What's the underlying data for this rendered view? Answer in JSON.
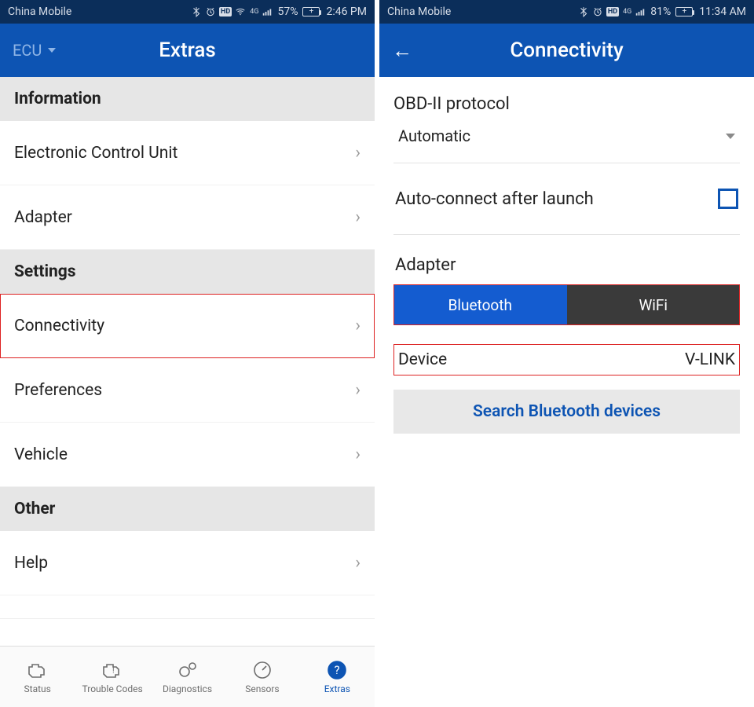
{
  "left": {
    "statusbar": {
      "carrier": "China Mobile",
      "battery_pct": "57%",
      "time": "2:46 PM"
    },
    "appbar": {
      "ecu_label": "ECU",
      "title": "Extras"
    },
    "sections": {
      "information": {
        "header": "Information",
        "items": [
          "Electronic Control Unit",
          "Adapter"
        ]
      },
      "settings": {
        "header": "Settings",
        "items": [
          "Connectivity",
          "Preferences",
          "Vehicle"
        ]
      },
      "other": {
        "header": "Other",
        "items": [
          "Help"
        ]
      }
    },
    "bottomnav": {
      "tabs": [
        "Status",
        "Trouble Codes",
        "Diagnostics",
        "Sensors",
        "Extras"
      ],
      "active_index": 4
    }
  },
  "right": {
    "statusbar": {
      "carrier": "China Mobile",
      "battery_pct": "81%",
      "time": "11:34 AM"
    },
    "appbar": {
      "title": "Connectivity"
    },
    "protocol": {
      "label": "OBD-II protocol",
      "value": "Automatic"
    },
    "autoconnect": {
      "label": "Auto-connect after launch",
      "checked": false
    },
    "adapter": {
      "label": "Adapter",
      "options": [
        "Bluetooth",
        "WiFi"
      ],
      "selected_index": 0
    },
    "device": {
      "label": "Device",
      "value": "V-LINK"
    },
    "search_button": "Search Bluetooth devices"
  }
}
